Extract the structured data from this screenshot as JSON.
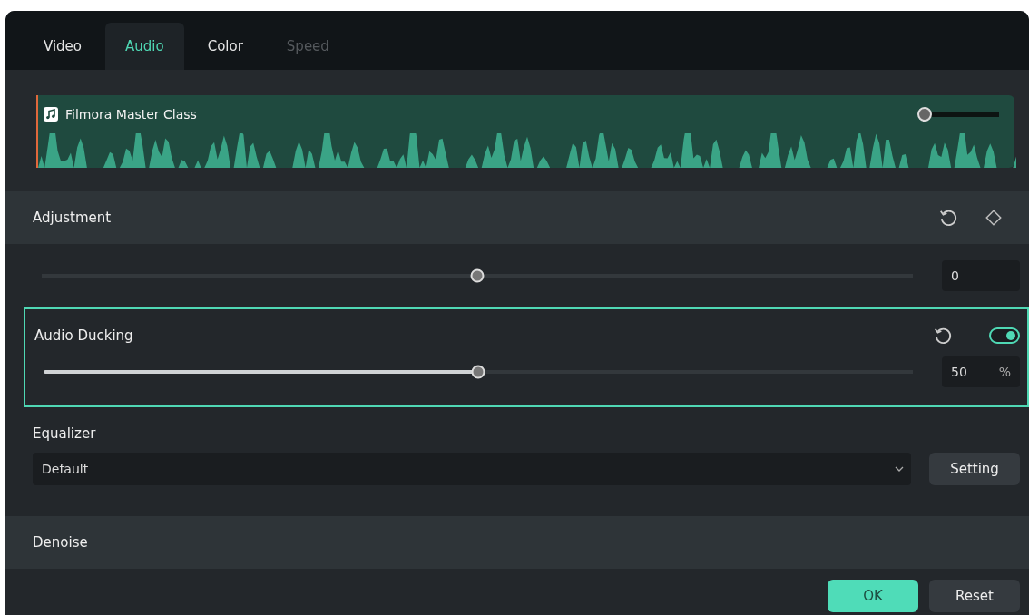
{
  "tabs": [
    {
      "label": "Video",
      "selected": false,
      "disabled": false
    },
    {
      "label": "Audio",
      "selected": true,
      "disabled": false
    },
    {
      "label": "Color",
      "selected": false,
      "disabled": false
    },
    {
      "label": "Speed",
      "selected": false,
      "disabled": true
    }
  ],
  "clip": {
    "title": "Filmora Master Class",
    "volume": {
      "level": 0.0
    }
  },
  "adjustment": {
    "title": "Adjustment"
  },
  "pitch": {
    "level": 0.5,
    "value": "0"
  },
  "ducking": {
    "label": "Audio Ducking",
    "on": true,
    "level": 0.5,
    "value": "50",
    "unit": "%"
  },
  "equalizer": {
    "label": "Equalizer",
    "value": "Default",
    "button": "Setting"
  },
  "denoise": {
    "title": "Denoise"
  },
  "buttons": {
    "ok": "OK",
    "reset": "Reset"
  }
}
